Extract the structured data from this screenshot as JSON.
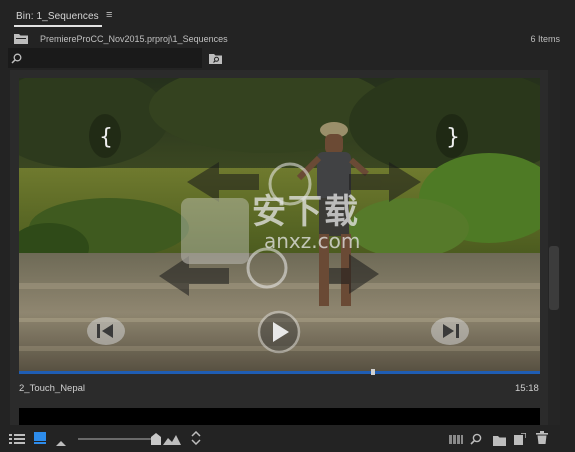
{
  "panel": {
    "tab_title": "Bin: 1_Sequences",
    "menu_icon": "hamburger-menu-icon",
    "path": "PremiereProCC_Nov2015.prproj\\1_Sequences",
    "item_count": "6 Items"
  },
  "search": {
    "value": "",
    "placeholder": ""
  },
  "clip": {
    "name": "2_Touch_Nepal",
    "duration": "15:18",
    "playhead_progress": 0.68
  },
  "watermark": {
    "text_cn": "安下载",
    "text_url": "anxz.com"
  },
  "colors": {
    "accent": "#1f5db3",
    "panel_bg": "#232323",
    "content_bg": "#2b2b2b"
  }
}
